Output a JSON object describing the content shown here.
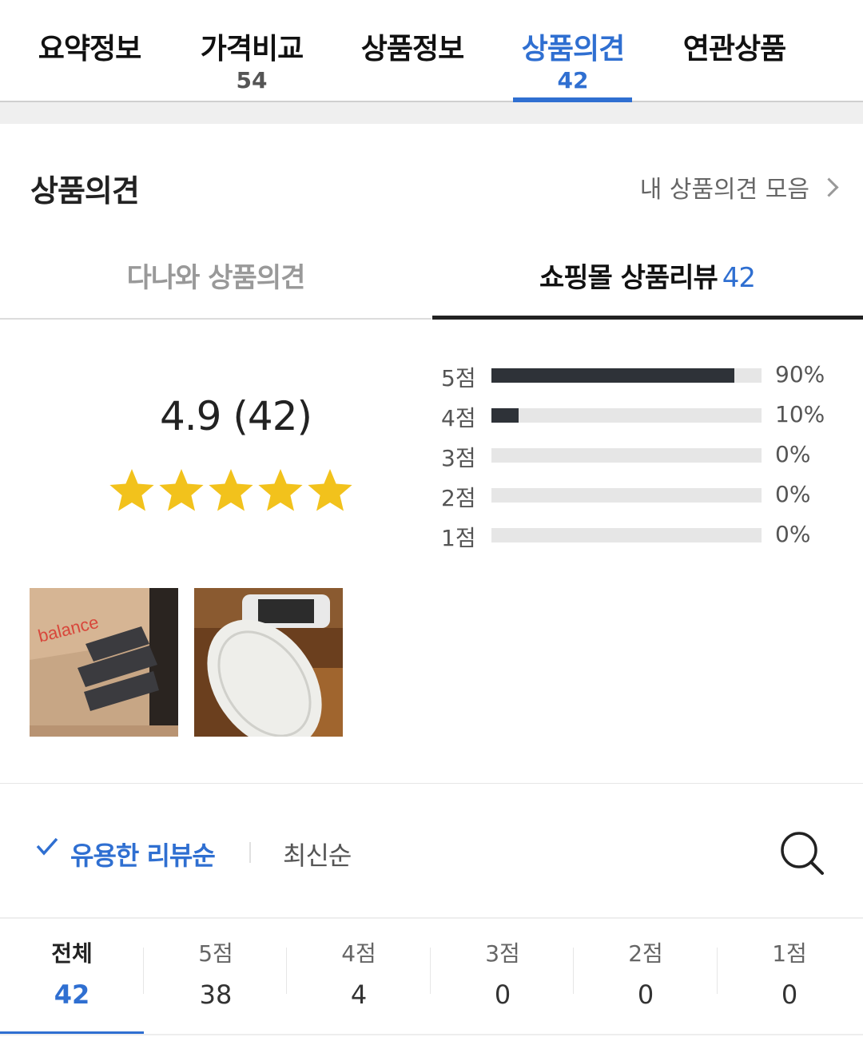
{
  "top_tabs": [
    {
      "label": "요약정보",
      "count": ""
    },
    {
      "label": "가격비교",
      "count": "54"
    },
    {
      "label": "상품정보",
      "count": ""
    },
    {
      "label": "상품의견",
      "count": "42"
    },
    {
      "label": "연관상품",
      "count": ""
    }
  ],
  "active_top_tab": "상품의견",
  "section": {
    "title": "상품의견",
    "my_reviews_link": "내 상품의견 모음"
  },
  "sub_tabs": {
    "left": "다나와 상품의견",
    "right": "쇼핑몰 상품리뷰",
    "right_count": "42"
  },
  "summary": {
    "score_text": "4.9 (42)",
    "stars": 5,
    "distribution": [
      {
        "label": "5점",
        "percent": 90,
        "pct_text": "90%"
      },
      {
        "label": "4점",
        "percent": 10,
        "pct_text": "10%"
      },
      {
        "label": "3점",
        "percent": 0,
        "pct_text": "0%"
      },
      {
        "label": "2점",
        "percent": 0,
        "pct_text": "0%"
      },
      {
        "label": "1점",
        "percent": 0,
        "pct_text": "0%"
      }
    ]
  },
  "photos": [
    {
      "icon": "box-photo",
      "text": "balance"
    },
    {
      "icon": "slipper-photo"
    }
  ],
  "sort": {
    "useful": "유용한 리뷰순",
    "newest": "최신순"
  },
  "filters": [
    {
      "label": "전체",
      "count": "42"
    },
    {
      "label": "5점",
      "count": "38"
    },
    {
      "label": "4점",
      "count": "4"
    },
    {
      "label": "3점",
      "count": "0"
    },
    {
      "label": "2점",
      "count": "0"
    },
    {
      "label": "1점",
      "count": "0"
    }
  ],
  "colors": {
    "accent": "#2f6fd1",
    "star": "#f2c21c",
    "bar": "#2e3238"
  }
}
